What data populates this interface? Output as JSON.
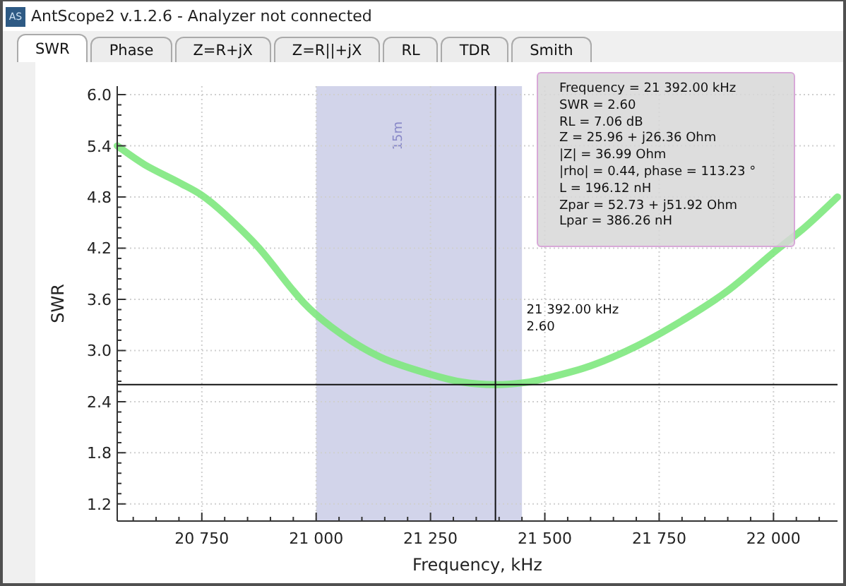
{
  "window": {
    "icon_label": "AS",
    "title": "AntScope2 v.1.2.6 - Analyzer not connected"
  },
  "tabs": [
    {
      "label": "SWR",
      "selected": true
    },
    {
      "label": "Phase",
      "selected": false
    },
    {
      "label": "Z=R+jX",
      "selected": false
    },
    {
      "label": "Z=R||+jX",
      "selected": false
    },
    {
      "label": "RL",
      "selected": false
    },
    {
      "label": "TDR",
      "selected": false
    },
    {
      "label": "Smith",
      "selected": false
    }
  ],
  "plot": {
    "cursor_label_lines": [
      "21 392.00 kHz",
      "2.60"
    ],
    "info_lines": [
      "Frequency = 21 392.00 kHz",
      "SWR = 2.60",
      "RL = 7.06 dB",
      "Z = 25.96 + j26.36 Ohm",
      "|Z| = 36.99 Ohm",
      "|rho| = 0.44, phase = 113.23 °",
      "L = 196.12 nH",
      "Zpar = 52.73 + j51.92 Ohm",
      "Lpar = 386.26 nH"
    ],
    "chart_data": {
      "type": "line",
      "xlabel": "Frequency, kHz",
      "ylabel": "SWR",
      "grid": true,
      "x": [
        20565,
        20625,
        20700,
        20750,
        20800,
        20875,
        20950,
        21000,
        21075,
        21150,
        21250,
        21320,
        21392,
        21450,
        21500,
        21600,
        21700,
        21800,
        21900,
        22000,
        22070,
        22140
      ],
      "series": [
        {
          "color": "#7ee87e",
          "values": [
            5.4,
            5.18,
            4.97,
            4.82,
            4.6,
            4.2,
            3.7,
            3.42,
            3.12,
            2.9,
            2.72,
            2.63,
            2.6,
            2.62,
            2.67,
            2.82,
            3.05,
            3.35,
            3.7,
            4.15,
            4.45,
            4.8
          ]
        }
      ],
      "bands": [
        {
          "axis": "x",
          "from": 21000,
          "to": 21450,
          "label": "15m",
          "color": "#d2d4ea"
        }
      ],
      "ref_lines": [
        {
          "axis": "x",
          "value": 21392,
          "color": "#111111"
        },
        {
          "axis": "y",
          "value": 2.6,
          "color": "#111111"
        }
      ],
      "xlim": [
        20565,
        22140
      ],
      "ylim": [
        1.0,
        6.1
      ],
      "xticks": [
        {
          "value": 20750,
          "label": "20 750"
        },
        {
          "value": 21000,
          "label": "21 000"
        },
        {
          "value": 21250,
          "label": "21 250"
        },
        {
          "value": 21500,
          "label": "21 500"
        },
        {
          "value": 21750,
          "label": "21 750"
        },
        {
          "value": 22000,
          "label": "22 000"
        }
      ],
      "yticks": [
        {
          "value": 6.0,
          "label": "6.0"
        },
        {
          "value": 5.4,
          "label": "5.4"
        },
        {
          "value": 4.8,
          "label": "4.8"
        },
        {
          "value": 4.2,
          "label": "4.2"
        },
        {
          "value": 3.6,
          "label": "3.6"
        },
        {
          "value": 3.0,
          "label": "3.0"
        },
        {
          "value": 2.4,
          "label": "2.4"
        },
        {
          "value": 1.8,
          "label": "1.8"
        },
        {
          "value": 1.2,
          "label": "1.2"
        }
      ]
    }
  }
}
